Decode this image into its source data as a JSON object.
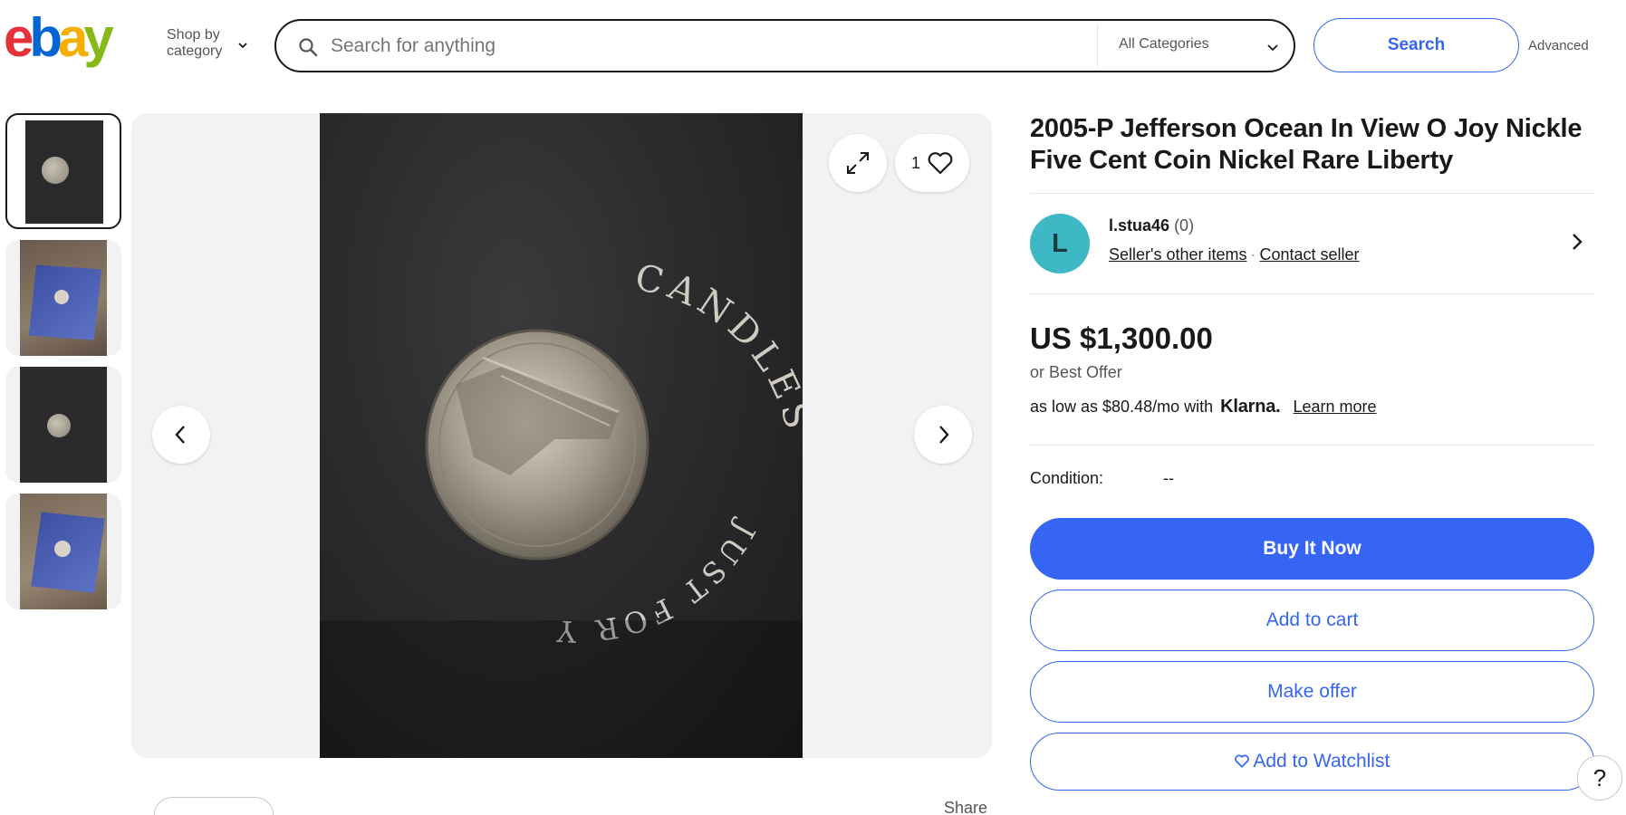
{
  "header": {
    "logo_letters": [
      "e",
      "b",
      "a",
      "y"
    ],
    "shop_by": "Shop by",
    "category": "category",
    "search_placeholder": "Search for anything",
    "category_select": "All Categories",
    "search_button": "Search",
    "advanced": "Advanced"
  },
  "gallery": {
    "thumbnail_count": 4,
    "active_thumbnail": 1,
    "favorites_count": "1",
    "share_label": "Share",
    "photo_text_top": "CANDLES",
    "photo_text_bottom": "JUST FOR YOU"
  },
  "listing": {
    "title": "2005-P Jefferson Ocean In View O Joy Nickle Five Cent Coin Nickel Rare Liberty",
    "seller": {
      "initial": "L",
      "name": "l.stua46",
      "feedback": "(0)",
      "other_items": "Seller's other items",
      "contact": "Contact seller"
    },
    "price": "US $1,300.00",
    "best_offer": "or Best Offer",
    "financing_prefix": "as low as $80.48/mo with",
    "financing_brand": "Klarna.",
    "learn_more": "Learn more",
    "condition_label": "Condition:",
    "condition_value": "--",
    "buy_now": "Buy It Now",
    "add_to_cart": "Add to cart",
    "make_offer": "Make offer",
    "add_to_watchlist": "Add to Watchlist"
  },
  "help": "?",
  "colors": {
    "primary": "#3665f3",
    "text": "#191919",
    "muted": "#555555",
    "panel": "#f2f2f2",
    "avatar": "#3eb8c4",
    "logo_e": "#e53238",
    "logo_b": "#0064d2",
    "logo_a": "#f5af02",
    "logo_y": "#86b817"
  }
}
